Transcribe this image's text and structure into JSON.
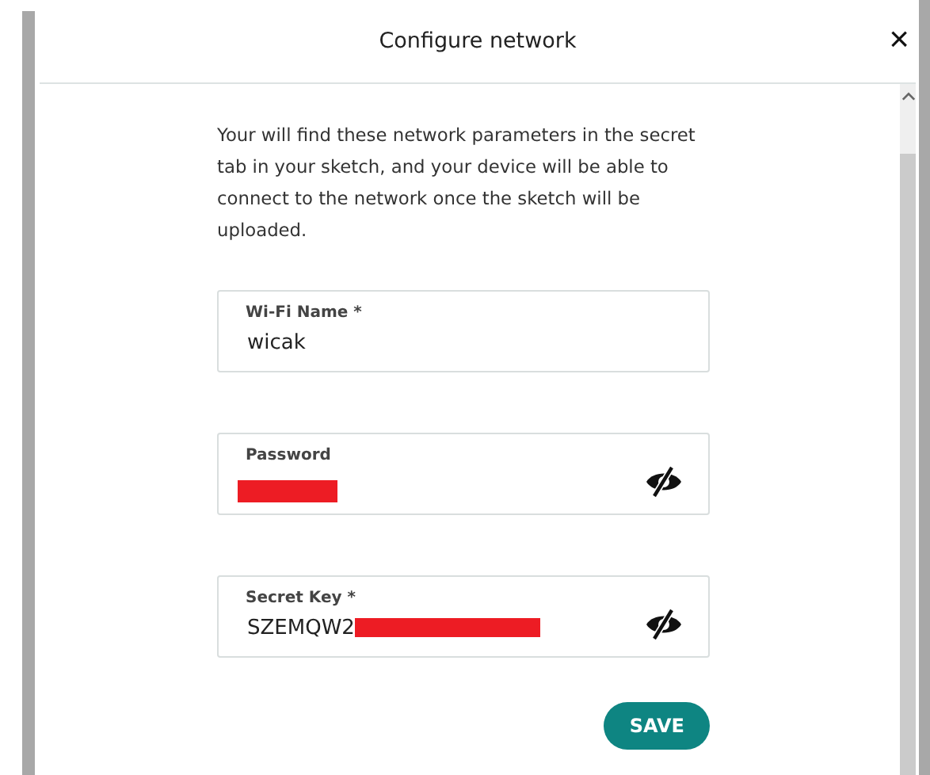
{
  "dialog": {
    "title": "Configure network",
    "close": "×"
  },
  "description": "Your will find these network parameters in the secret tab in your sketch, and your device will be able to connect to the network once the sketch will be uploaded.",
  "fields": [
    {
      "label": "Wi-Fi Name *",
      "value": "wicak",
      "redacted": false,
      "toggle": false
    },
    {
      "label": "Password",
      "redacted": true,
      "toggle": true
    },
    {
      "label": "Secret Key *",
      "value": "SZEMQW2",
      "redacted": true,
      "toggle": true
    }
  ],
  "save_button": "SAVE"
}
